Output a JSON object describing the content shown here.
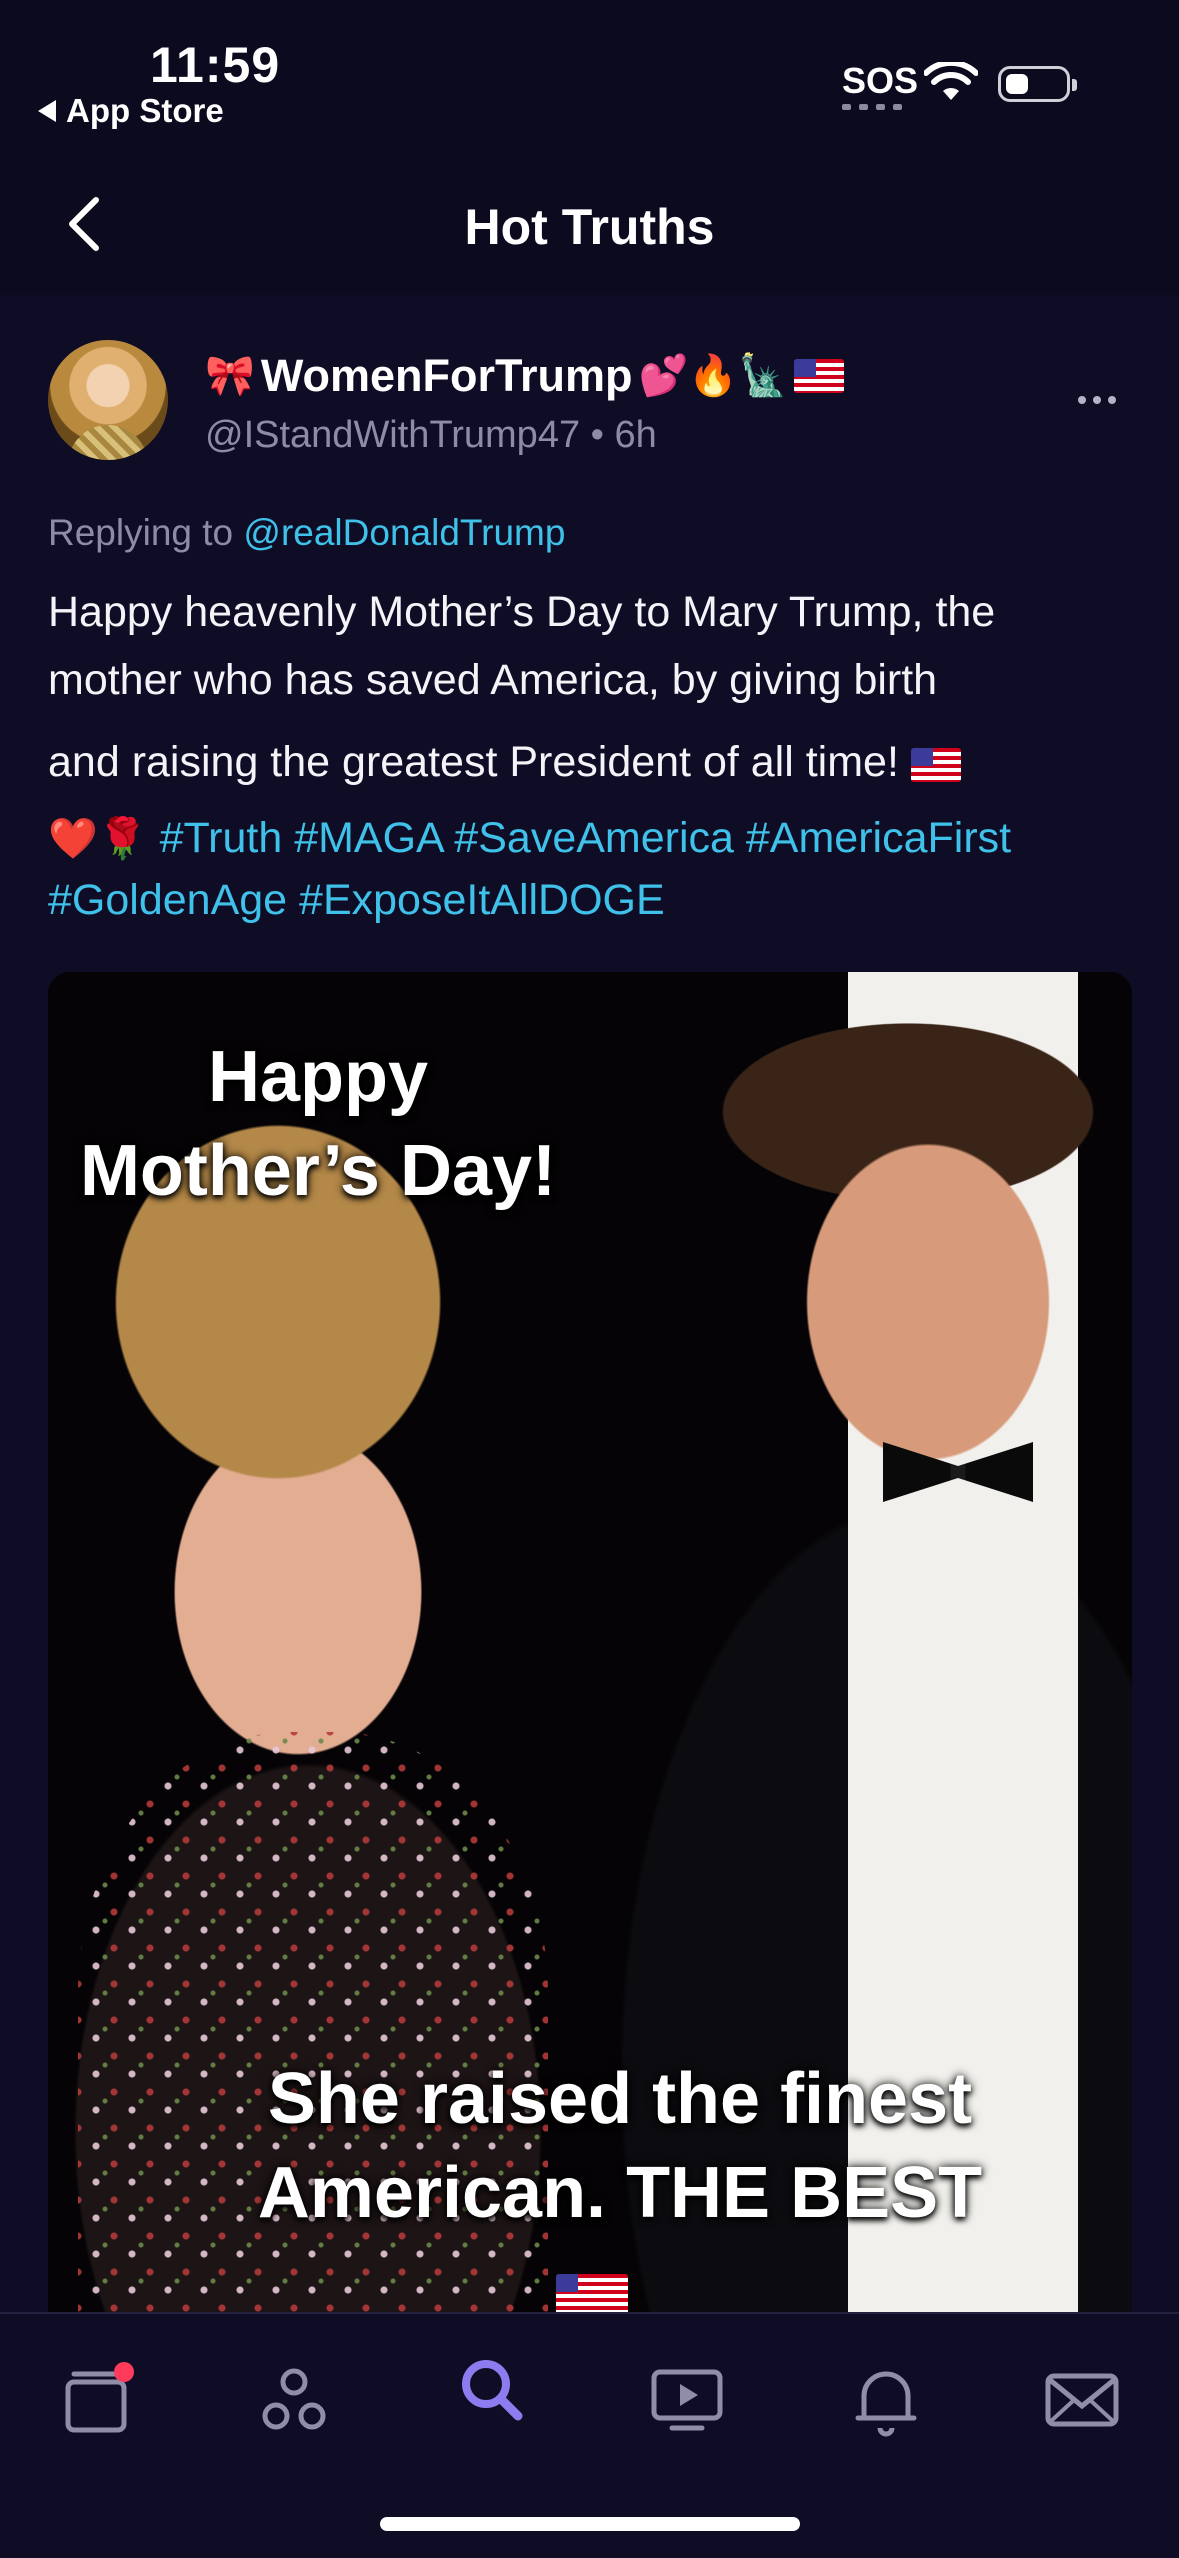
{
  "status_bar": {
    "time": "11:59",
    "back_label": "App Store",
    "sos": "SOS"
  },
  "nav": {
    "title": "Hot Truths",
    "back_icon": "chevron-left-icon"
  },
  "post": {
    "display_name": "WomenForTrump",
    "name_emojis_before": "🎀",
    "name_emojis_after": "💕🔥🗽",
    "handle": "@IStandWithTrump47",
    "time_ago": "• 6h",
    "replying_prefix": "Replying to",
    "replying_mention": "@realDonaldTrump",
    "body_line1": "Happy heavenly Mother’s Day to Mary Trump, the",
    "body_line2": "mother who has saved America, by giving birth",
    "body_line3": "and raising the greatest President of all time!",
    "body_emojis": "❤️🌹",
    "hashtags_line1": "#Truth #MAGA #SaveAmerica #AmericaFirst",
    "hashtags_line2": "#GoldenAge #ExposeItAllDOGE",
    "image": {
      "top_text_1": "Happy",
      "top_text_2": "Mother’s Day!",
      "bottom_text_1": "She raised the finest",
      "bottom_text_2": "American. THE BEST"
    }
  },
  "tabbar": {
    "items": [
      "home-icon",
      "groups-icon",
      "search-icon",
      "video-icon",
      "notifications-icon",
      "messages-icon"
    ],
    "active": "search-icon",
    "active_color": "#8c7cf0",
    "badge_color": "#ff3b5c"
  },
  "colors": {
    "background": "#0f0d26",
    "link": "#3fc1e9",
    "muted": "#8d8ba6"
  }
}
